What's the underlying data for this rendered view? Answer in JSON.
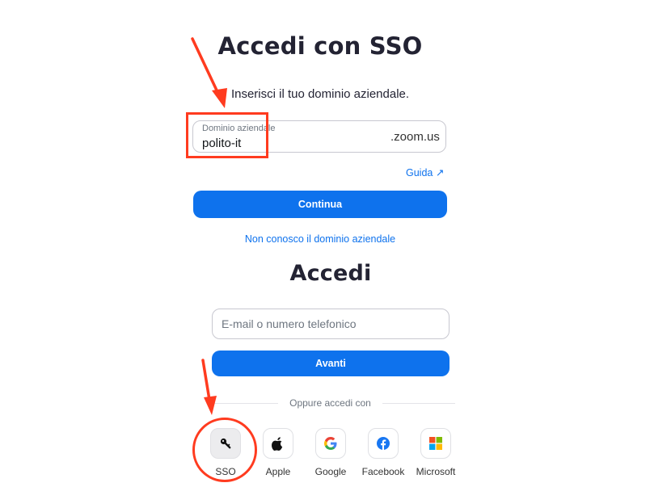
{
  "sso": {
    "title": "Accedi con SSO",
    "subtitle": "Inserisci il tuo dominio aziendale.",
    "domain_label": "Dominio aziendale",
    "domain_value": "polito-it",
    "domain_suffix": ".zoom.us",
    "help_link": "Guida ↗",
    "continue_label": "Continua",
    "unknown_domain_link": "Non conosco il dominio aziendale"
  },
  "login": {
    "title": "Accedi",
    "email_placeholder": "E-mail o numero telefonico",
    "next_label": "Avanti",
    "or_text": "Oppure accedi con"
  },
  "social": {
    "sso": "SSO",
    "apple": "Apple",
    "google": "Google",
    "facebook": "Facebook",
    "microsoft": "Microsoft"
  },
  "icons": {
    "sso": "key-icon",
    "apple": "apple-icon",
    "google": "google-icon",
    "facebook": "facebook-icon",
    "microsoft": "microsoft-icon"
  },
  "colors": {
    "accent": "#0e72ed",
    "annotation": "#ff3b1f"
  }
}
